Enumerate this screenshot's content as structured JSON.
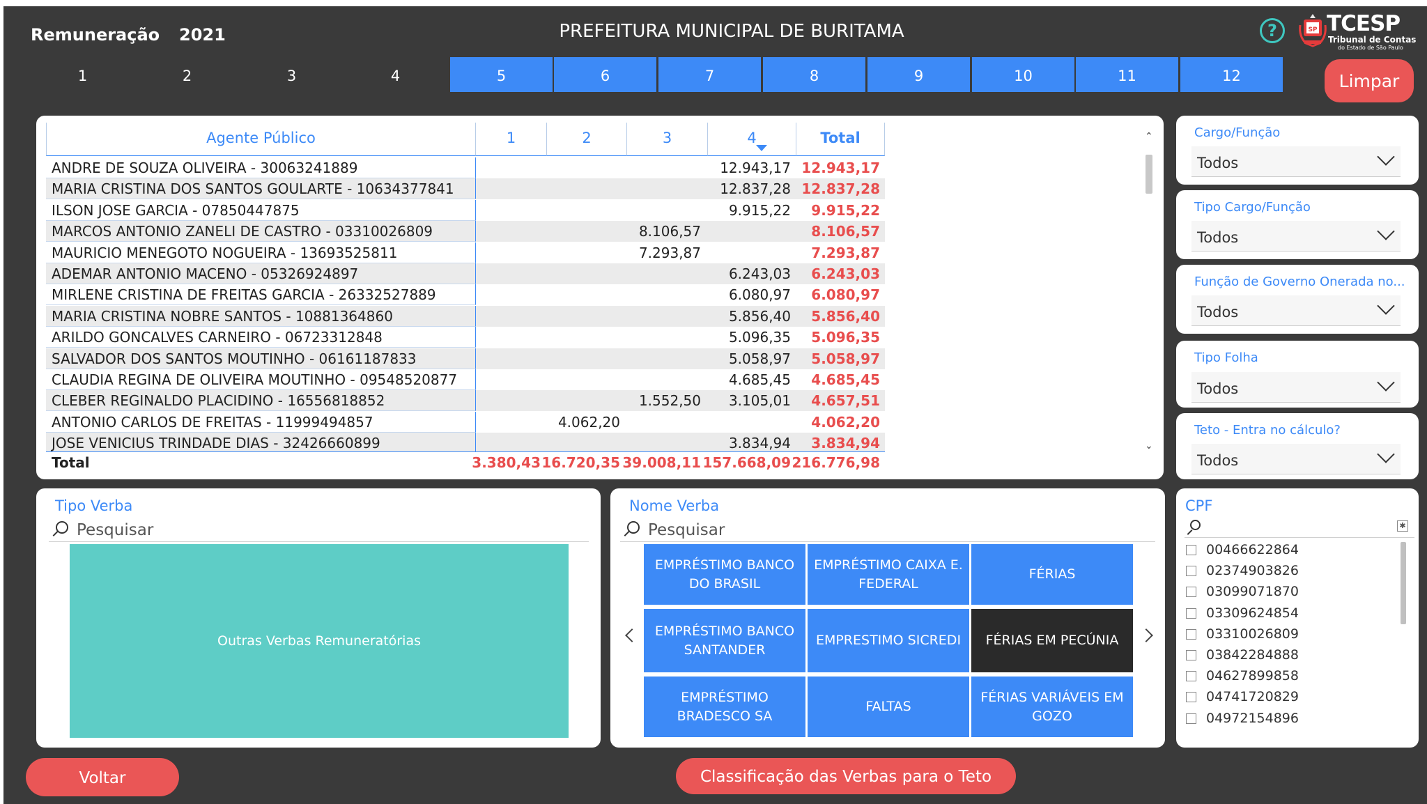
{
  "header": {
    "app_title": "Remuneração",
    "year": "2021",
    "org_title": "PREFEITURA MUNICIPAL DE BURITAMA",
    "help_glyph": "?",
    "logo": {
      "word": "TCESP",
      "line1": "Tribunal de Contas",
      "line2": "do Estado de São Paulo"
    }
  },
  "months": {
    "labels": [
      "1",
      "2",
      "3",
      "4",
      "5",
      "6",
      "7",
      "8",
      "9",
      "10",
      "11",
      "12"
    ],
    "active": [
      false,
      false,
      false,
      false,
      true,
      true,
      true,
      true,
      true,
      true,
      true,
      true
    ]
  },
  "clear_button": "Limpar",
  "table": {
    "headers": [
      "Agente Público",
      "1",
      "2",
      "3",
      "4",
      "Total"
    ],
    "sorted_by": "Total",
    "rows": [
      {
        "name": "ANDRE DE SOUZA OLIVEIRA - 30063241889",
        "m1": "",
        "m2": "",
        "m3": "",
        "m4": "12.943,17",
        "total": "12.943,17"
      },
      {
        "name": "MARIA CRISTINA DOS SANTOS GOULARTE - 10634377841",
        "m1": "",
        "m2": "",
        "m3": "",
        "m4": "12.837,28",
        "total": "12.837,28"
      },
      {
        "name": "ILSON JOSE GARCIA - 07850447875",
        "m1": "",
        "m2": "",
        "m3": "",
        "m4": "9.915,22",
        "total": "9.915,22"
      },
      {
        "name": "MARCOS ANTONIO ZANELI DE CASTRO - 03310026809",
        "m1": "",
        "m2": "",
        "m3": "8.106,57",
        "m4": "",
        "total": "8.106,57"
      },
      {
        "name": "MAURICIO MENEGOTO NOGUEIRA - 13693525811",
        "m1": "",
        "m2": "",
        "m3": "7.293,87",
        "m4": "",
        "total": "7.293,87"
      },
      {
        "name": "ADEMAR ANTONIO MACENO - 05326924897",
        "m1": "",
        "m2": "",
        "m3": "",
        "m4": "6.243,03",
        "total": "6.243,03"
      },
      {
        "name": "MIRLENE CRISTINA DE FREITAS GARCIA - 26332527889",
        "m1": "",
        "m2": "",
        "m3": "",
        "m4": "6.080,97",
        "total": "6.080,97"
      },
      {
        "name": "MARIA CRISTINA NOBRE SANTOS - 10881364860",
        "m1": "",
        "m2": "",
        "m3": "",
        "m4": "5.856,40",
        "total": "5.856,40"
      },
      {
        "name": "ARILDO GONCALVES CARNEIRO - 06723312848",
        "m1": "",
        "m2": "",
        "m3": "",
        "m4": "5.096,35",
        "total": "5.096,35"
      },
      {
        "name": "SALVADOR DOS SANTOS MOUTINHO - 06161187833",
        "m1": "",
        "m2": "",
        "m3": "",
        "m4": "5.058,97",
        "total": "5.058,97"
      },
      {
        "name": "CLAUDIA REGINA DE OLIVEIRA MOUTINHO - 09548520877",
        "m1": "",
        "m2": "",
        "m3": "",
        "m4": "4.685,45",
        "total": "4.685,45"
      },
      {
        "name": "CLEBER REGINALDO PLACIDINO - 16556818852",
        "m1": "",
        "m2": "",
        "m3": "1.552,50",
        "m4": "3.105,01",
        "total": "4.657,51"
      },
      {
        "name": "ANTONIO CARLOS DE FREITAS - 11999494857",
        "m1": "",
        "m2": "4.062,20",
        "m3": "",
        "m4": "",
        "total": "4.062,20"
      },
      {
        "name": "JOSE VENICIUS TRINDADE DIAS - 32426660899",
        "m1": "",
        "m2": "",
        "m3": "",
        "m4": "3.834,94",
        "total": "3.834,94"
      }
    ],
    "total_row": {
      "label": "Total",
      "m1": "3.380,43",
      "m2": "16.720,35",
      "m3": "39.008,11",
      "m4": "157.668,09",
      "total": "216.776,98"
    }
  },
  "filters": [
    {
      "label": "Cargo/Função",
      "value": "Todos"
    },
    {
      "label": "Tipo Cargo/Função",
      "value": "Todos"
    },
    {
      "label": "Função de Governo Onerada no...",
      "value": "Todos"
    },
    {
      "label": "Tipo Folha",
      "value": "Todos"
    },
    {
      "label": "Teto - Entra no cálculo?",
      "value": "Todos"
    }
  ],
  "tipo_verba": {
    "title": "Tipo Verba",
    "search_placeholder": "Pesquisar",
    "tile": "Outras Verbas Remuneratórias"
  },
  "nome_verba": {
    "title": "Nome Verba",
    "search_placeholder": "Pesquisar",
    "tiles": [
      "EMPRÉSTIMO BANCO DO BRASIL",
      "EMPRÉSTIMO CAIXA E. FEDERAL",
      "FÉRIAS",
      "EMPRÉSTIMO BANCO SANTANDER",
      "EMPRESTIMO SICREDI",
      "FÉRIAS EM PECÚNIA",
      "EMPRÉSTIMO BRADESCO SA",
      "FALTAS",
      "FÉRIAS VARIÁVEIS EM GOZO"
    ],
    "selected_tile": "FÉRIAS EM PECÚNIA"
  },
  "cpf": {
    "title": "CPF",
    "items": [
      "00466622864",
      "02374903826",
      "03099071870",
      "03309624854",
      "03310026809",
      "03842284888",
      "04627899858",
      "04741720829",
      "04972154896"
    ]
  },
  "footer": {
    "back_label": "Voltar",
    "classify_label": "Classificação das Verbas para o Teto"
  },
  "colors": {
    "accent_blue": "#3d8af7",
    "accent_red": "#ea5656",
    "total_red": "#e84d4d",
    "teal": "#5ecdc6",
    "background": "#3a3a3a"
  }
}
